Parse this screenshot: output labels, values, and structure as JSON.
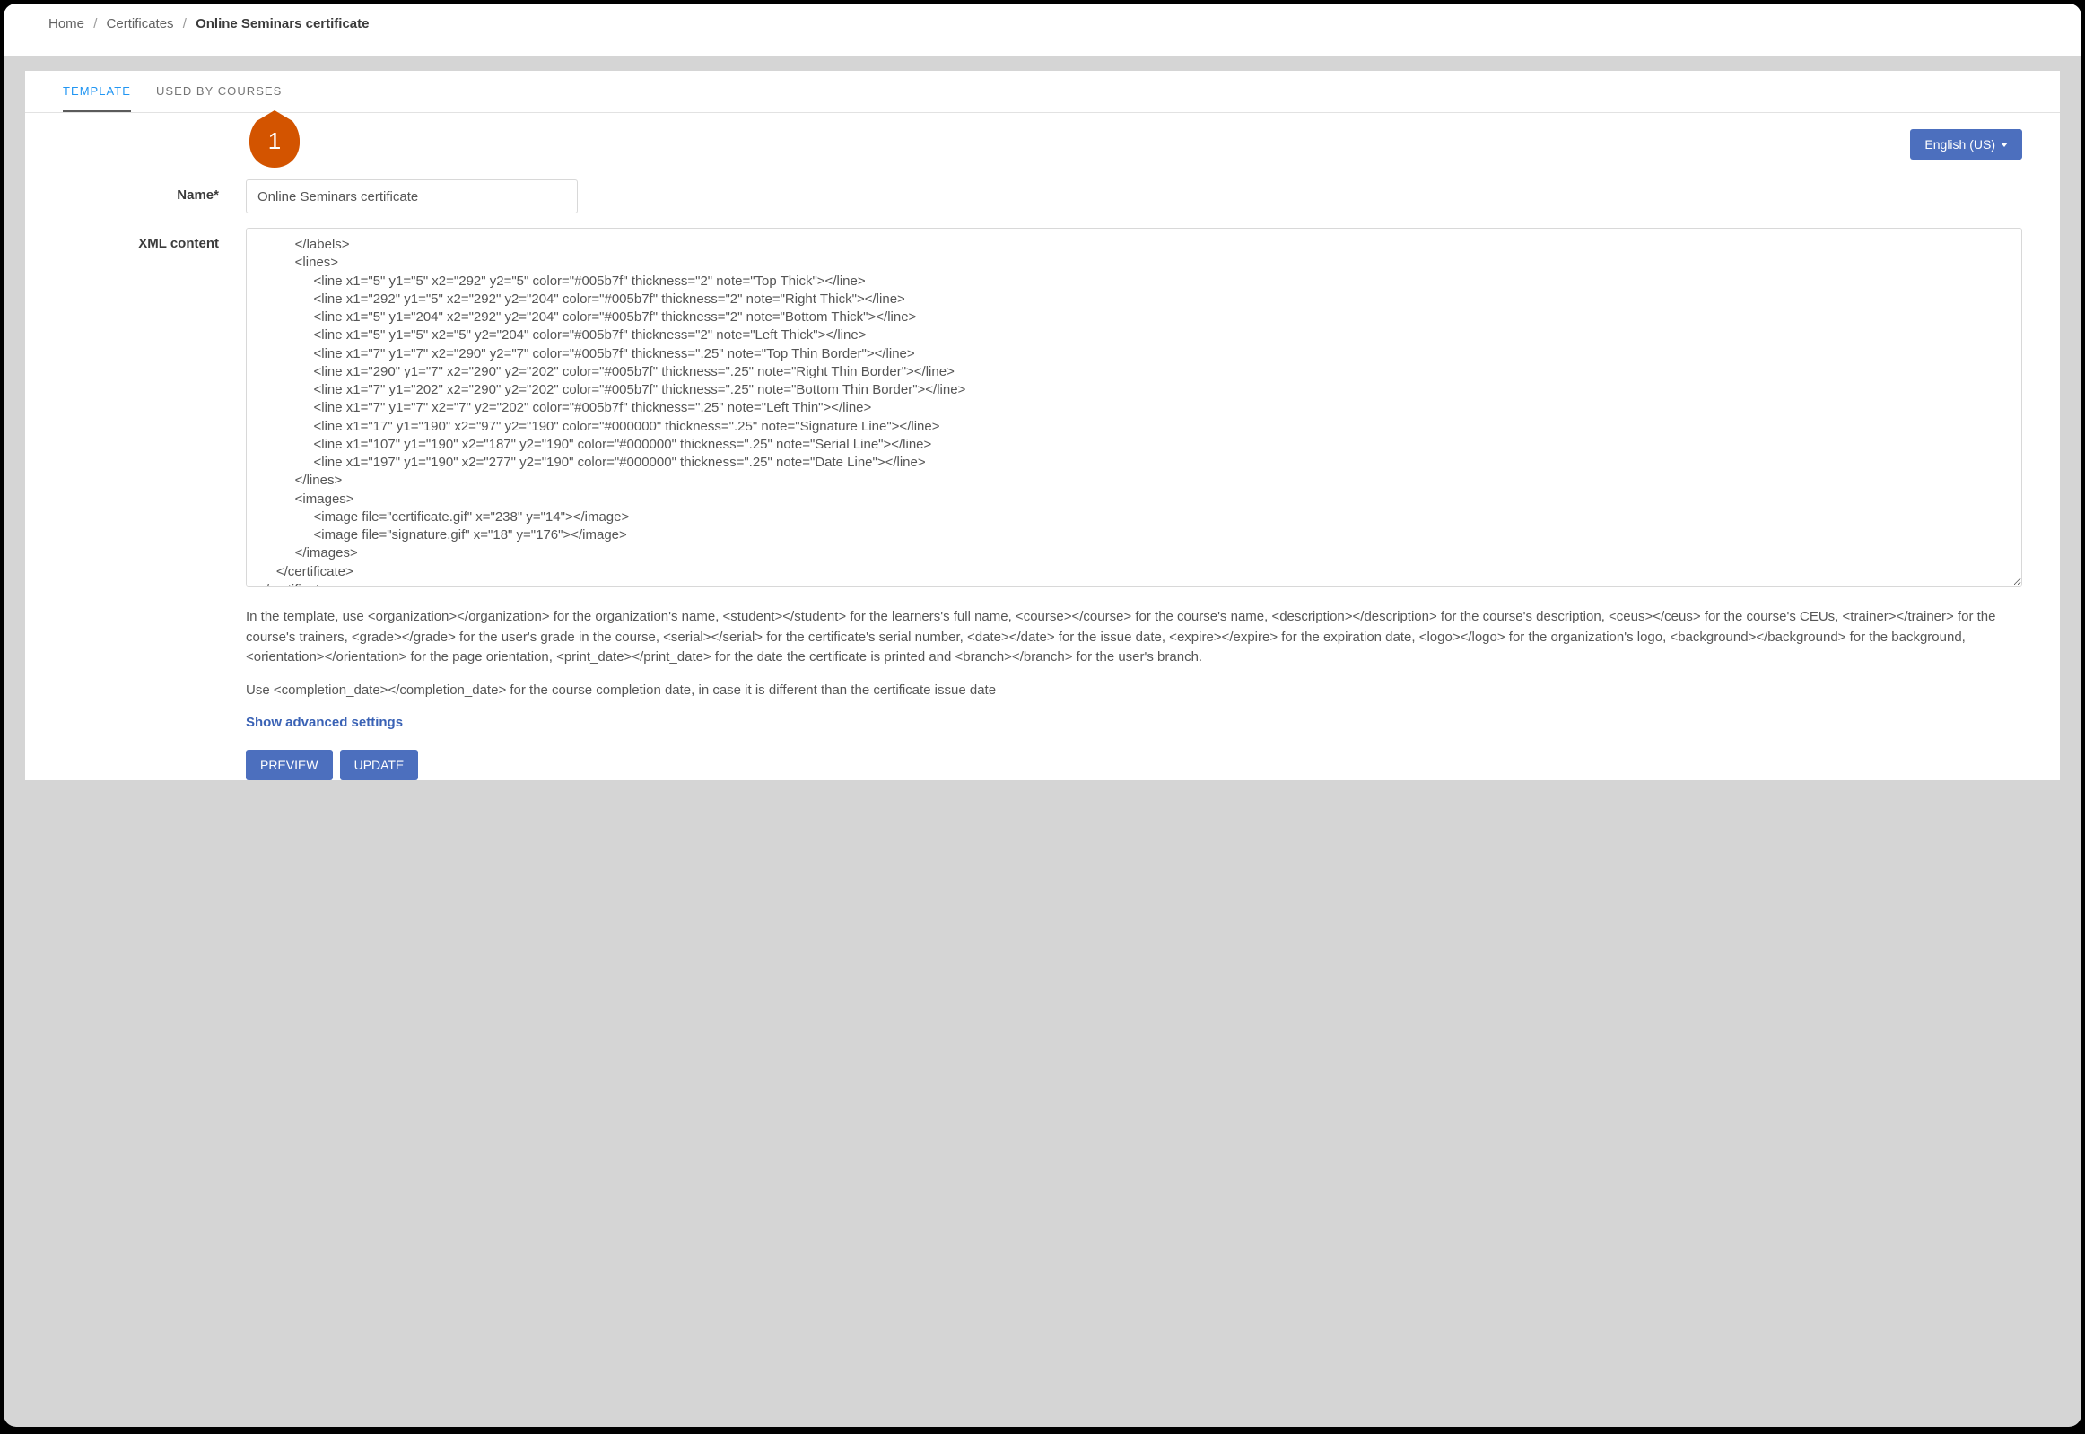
{
  "breadcrumb": {
    "home": "Home",
    "mid": "Certificates",
    "current": "Online Seminars certificate"
  },
  "tabs": {
    "template": "TEMPLATE",
    "used_by": "USED BY COURSES"
  },
  "lang": {
    "label": "English (US)"
  },
  "form": {
    "name_label": "Name*",
    "name_value": "Online Seminars certificate",
    "xml_label": "XML content",
    "xml_value": "          </labels>\n          <lines>\n               <line x1=\"5\" y1=\"5\" x2=\"292\" y2=\"5\" color=\"#005b7f\" thickness=\"2\" note=\"Top Thick\"></line>\n               <line x1=\"292\" y1=\"5\" x2=\"292\" y2=\"204\" color=\"#005b7f\" thickness=\"2\" note=\"Right Thick\"></line>\n               <line x1=\"5\" y1=\"204\" x2=\"292\" y2=\"204\" color=\"#005b7f\" thickness=\"2\" note=\"Bottom Thick\"></line>\n               <line x1=\"5\" y1=\"5\" x2=\"5\" y2=\"204\" color=\"#005b7f\" thickness=\"2\" note=\"Left Thick\"></line>\n               <line x1=\"7\" y1=\"7\" x2=\"290\" y2=\"7\" color=\"#005b7f\" thickness=\".25\" note=\"Top Thin Border\"></line>\n               <line x1=\"290\" y1=\"7\" x2=\"290\" y2=\"202\" color=\"#005b7f\" thickness=\".25\" note=\"Right Thin Border\"></line>\n               <line x1=\"7\" y1=\"202\" x2=\"290\" y2=\"202\" color=\"#005b7f\" thickness=\".25\" note=\"Bottom Thin Border\"></line>\n               <line x1=\"7\" y1=\"7\" x2=\"7\" y2=\"202\" color=\"#005b7f\" thickness=\".25\" note=\"Left Thin\"></line>\n               <line x1=\"17\" y1=\"190\" x2=\"97\" y2=\"190\" color=\"#000000\" thickness=\".25\" note=\"Signature Line\"></line>\n               <line x1=\"107\" y1=\"190\" x2=\"187\" y2=\"190\" color=\"#000000\" thickness=\".25\" note=\"Serial Line\"></line>\n               <line x1=\"197\" y1=\"190\" x2=\"277\" y2=\"190\" color=\"#000000\" thickness=\".25\" note=\"Date Line\"></line>\n          </lines>\n          <images>\n               <image file=\"certificate.gif\" x=\"238\" y=\"14\"></image>\n               <image file=\"signature.gif\" x=\"18\" y=\"176\"></image>\n          </images>\n     </certificate>\n</certificates>"
  },
  "help": {
    "p1": "In the template, use <organization></organization> for the organization's name, <student></student> for the learners's full name, <course></course> for the course's name, <description></description> for the course's description, <ceus></ceus> for the course's CEUs, <trainer></trainer> for the course's trainers, <grade></grade> for the user's grade in the course, <serial></serial> for the certificate's serial number, <date></date> for the issue date, <expire></expire> for the expiration date, <logo></logo> for the organization's logo, <background></background> for the background, <orientation></orientation> for the page orientation, <print_date></print_date> for the date the certificate is printed and <branch></branch> for the user's branch.",
    "p2": "Use <completion_date></completion_date> for the course completion date, in case it is different than the certificate issue date",
    "advanced": "Show advanced settings"
  },
  "actions": {
    "preview": "PREVIEW",
    "update": "UPDATE"
  },
  "callout": {
    "num": "1"
  }
}
